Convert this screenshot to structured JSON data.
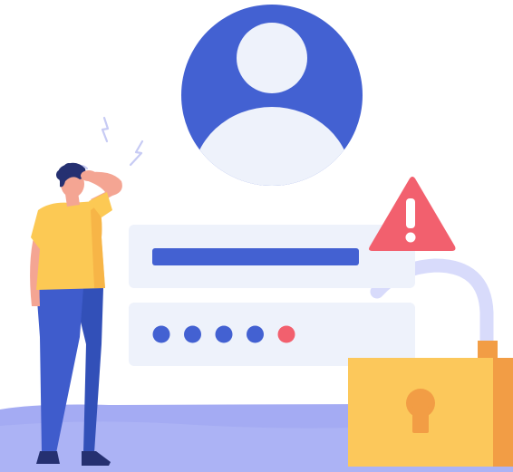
{
  "illustration": {
    "subject": "forgotten-password-locked-account",
    "icons": [
      "user-avatar-icon",
      "warning-triangle-icon",
      "padlock-icon",
      "keyhole-icon",
      "lightning-icon"
    ],
    "form": {
      "username_field_state": "filled",
      "password_dot_count": 5,
      "error_dot_count": 1
    },
    "colors": {
      "primary_blue": "#4361d2",
      "light_panel": "#eef2fb",
      "floor": "#a4abf3",
      "warning_red": "#f2606e",
      "lock_yellow": "#fcc85b",
      "lock_shadow": "#f29d45",
      "shackle": "#d8dbfb",
      "shirt_yellow": "#fcc954",
      "pants_blue": "#3f5ccc",
      "skin": "#f4a593",
      "hair": "#253071"
    }
  }
}
